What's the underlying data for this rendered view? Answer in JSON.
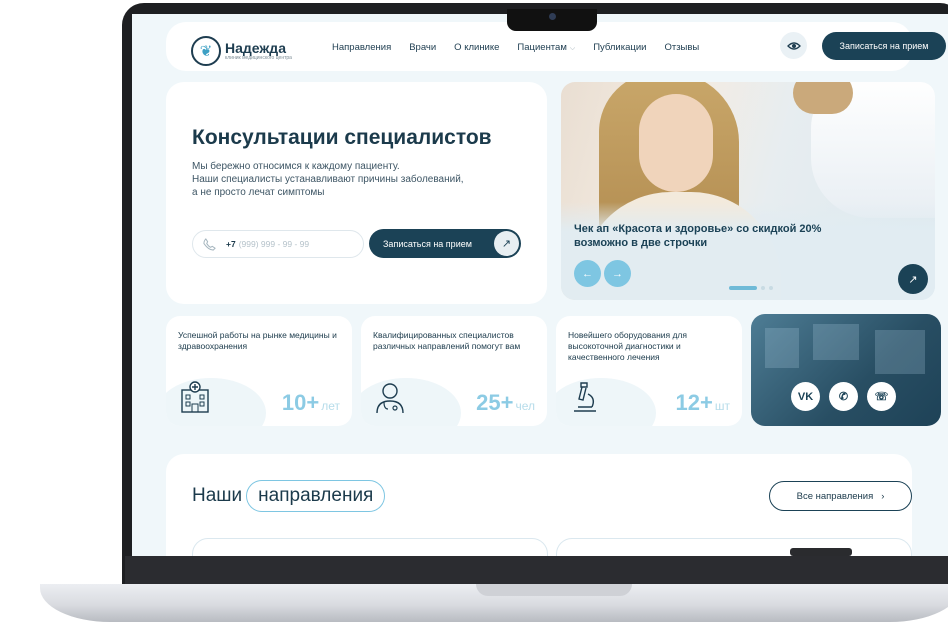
{
  "logo": {
    "name": "Надежда",
    "subtitle": "клиник медицинского центра"
  },
  "nav": {
    "items": [
      "Направления",
      "Врачи",
      "О клинике",
      "Пациентам",
      "Публикации",
      "Отзывы"
    ],
    "accessibility_icon": "eye-icon",
    "book_label": "Записаться на прием"
  },
  "hero": {
    "title": "Консультации специалистов",
    "text": "Мы бережно относимся к каждому пациенту.\nНаши специалисты устанавливают причины заболеваний,\nа не просто лечат симптомы",
    "phone_code": "+7",
    "phone_placeholder": "(999) 999 - 99 - 99",
    "book_label": "Записаться на прием"
  },
  "banner": {
    "text": "Чек ап «Красота и здоровье» со скидкой 20% возможно в две строчки",
    "slides_total": 3,
    "slide_active": 1
  },
  "stats": [
    {
      "text": "Успешной работы на рынке медицины и здравоохранения",
      "value": "10+",
      "unit": "лет",
      "icon": "hospital-icon"
    },
    {
      "text": "Квалифицированных специалистов различных направлений помогут вам",
      "value": "25+",
      "unit": "чел",
      "icon": "doctor-icon"
    },
    {
      "text": "Новейшего оборудования для высокоточной диагностики и качественного лечения",
      "value": "12+",
      "unit": "шт",
      "icon": "microscope-icon"
    }
  ],
  "social": {
    "vk": "vk",
    "whatsapp": "whatsapp-icon",
    "viber": "viber-icon"
  },
  "directions": {
    "title_plain": "Наши",
    "title_pill": "направления",
    "all_label": "Все направления"
  },
  "colors": {
    "primary": "#1b4256",
    "accent": "#7ec6e2",
    "background": "#f0f7fa"
  }
}
